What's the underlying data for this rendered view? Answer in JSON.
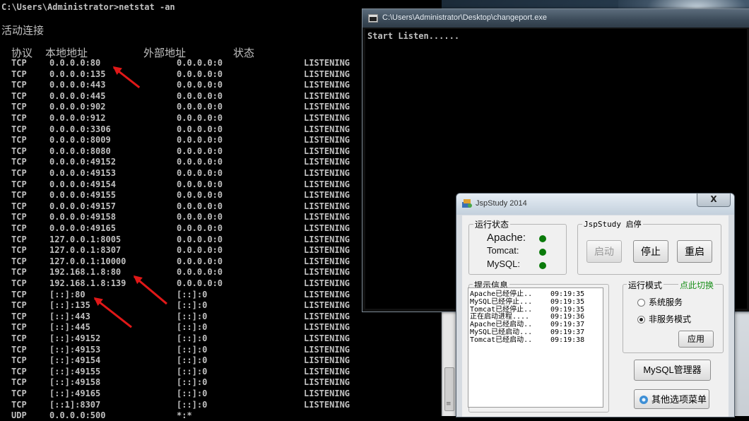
{
  "cmd": {
    "prompt": "C:\\Users\\Administrator>netstat -an",
    "section_title": "活动连接",
    "headers": [
      "协议",
      "本地地址",
      "外部地址",
      "状态"
    ],
    "rows": [
      [
        "TCP",
        "0.0.0.0:80",
        "0.0.0.0:0",
        "LISTENING"
      ],
      [
        "TCP",
        "0.0.0.0:135",
        "0.0.0.0:0",
        "LISTENING"
      ],
      [
        "TCP",
        "0.0.0.0:443",
        "0.0.0.0:0",
        "LISTENING"
      ],
      [
        "TCP",
        "0.0.0.0:445",
        "0.0.0.0:0",
        "LISTENING"
      ],
      [
        "TCP",
        "0.0.0.0:902",
        "0.0.0.0:0",
        "LISTENING"
      ],
      [
        "TCP",
        "0.0.0.0:912",
        "0.0.0.0:0",
        "LISTENING"
      ],
      [
        "TCP",
        "0.0.0.0:3306",
        "0.0.0.0:0",
        "LISTENING"
      ],
      [
        "TCP",
        "0.0.0.0:8009",
        "0.0.0.0:0",
        "LISTENING"
      ],
      [
        "TCP",
        "0.0.0.0:8080",
        "0.0.0.0:0",
        "LISTENING"
      ],
      [
        "TCP",
        "0.0.0.0:49152",
        "0.0.0.0:0",
        "LISTENING"
      ],
      [
        "TCP",
        "0.0.0.0:49153",
        "0.0.0.0:0",
        "LISTENING"
      ],
      [
        "TCP",
        "0.0.0.0:49154",
        "0.0.0.0:0",
        "LISTENING"
      ],
      [
        "TCP",
        "0.0.0.0:49155",
        "0.0.0.0:0",
        "LISTENING"
      ],
      [
        "TCP",
        "0.0.0.0:49157",
        "0.0.0.0:0",
        "LISTENING"
      ],
      [
        "TCP",
        "0.0.0.0:49158",
        "0.0.0.0:0",
        "LISTENING"
      ],
      [
        "TCP",
        "0.0.0.0:49165",
        "0.0.0.0:0",
        "LISTENING"
      ],
      [
        "TCP",
        "127.0.0.1:8005",
        "0.0.0.0:0",
        "LISTENING"
      ],
      [
        "TCP",
        "127.0.0.1:8307",
        "0.0.0.0:0",
        "LISTENING"
      ],
      [
        "TCP",
        "127.0.0.1:10000",
        "0.0.0.0:0",
        "LISTENING"
      ],
      [
        "TCP",
        "192.168.1.8:80",
        "0.0.0.0:0",
        "LISTENING"
      ],
      [
        "TCP",
        "192.168.1.8:139",
        "0.0.0.0:0",
        "LISTENING"
      ],
      [
        "TCP",
        "[::]:80",
        "[::]:0",
        "LISTENING"
      ],
      [
        "TCP",
        "[::]:135",
        "[::]:0",
        "LISTENING"
      ],
      [
        "TCP",
        "[::]:443",
        "[::]:0",
        "LISTENING"
      ],
      [
        "TCP",
        "[::]:445",
        "[::]:0",
        "LISTENING"
      ],
      [
        "TCP",
        "[::]:49152",
        "[::]:0",
        "LISTENING"
      ],
      [
        "TCP",
        "[::]:49153",
        "[::]:0",
        "LISTENING"
      ],
      [
        "TCP",
        "[::]:49154",
        "[::]:0",
        "LISTENING"
      ],
      [
        "TCP",
        "[::]:49155",
        "[::]:0",
        "LISTENING"
      ],
      [
        "TCP",
        "[::]:49158",
        "[::]:0",
        "LISTENING"
      ],
      [
        "TCP",
        "[::]:49165",
        "[::]:0",
        "LISTENING"
      ],
      [
        "TCP",
        "[::1]:8307",
        "[::]:0",
        "LISTENING"
      ],
      [
        "UDP",
        "0.0.0.0:500",
        "*:*",
        ""
      ]
    ]
  },
  "changeport": {
    "title": "C:\\Users\\Administrator\\Desktop\\changeport.exe",
    "output": "Start Listen......"
  },
  "jsp": {
    "title": "JspStudy 2014",
    "close_label": "X",
    "status_group": "运行状态",
    "services": [
      "Apache:",
      "Tomcat:",
      "MySQL:"
    ],
    "control_group": "JspStudy 启停",
    "start_label": "启动",
    "stop_label": "停止",
    "restart_label": "重启",
    "log_group": "提示信息",
    "log": [
      [
        "Apache已经停止..",
        "09:19:35"
      ],
      [
        "MySQL已经停止...",
        "09:19:35"
      ],
      [
        "Tomcat已经停止..",
        "09:19:35"
      ],
      [
        "正在启动进程....",
        "09:19:36"
      ],
      [
        "Apache已经启动..",
        "09:19:37"
      ],
      [
        "MySQL已经启动...",
        "09:19:37"
      ],
      [
        "Tomcat已经启动..",
        "09:19:38"
      ]
    ],
    "mode_group": "运行模式",
    "mode_switch": "点此切换",
    "mode_service": "系统服务",
    "mode_nonservice": "非服务模式",
    "apply_label": "应用",
    "mysql_manager": "MySQL管理器",
    "other_menu": "其他选项菜单",
    "status_color": "#0a7a0a",
    "switch_color": "#1a8f1a"
  }
}
